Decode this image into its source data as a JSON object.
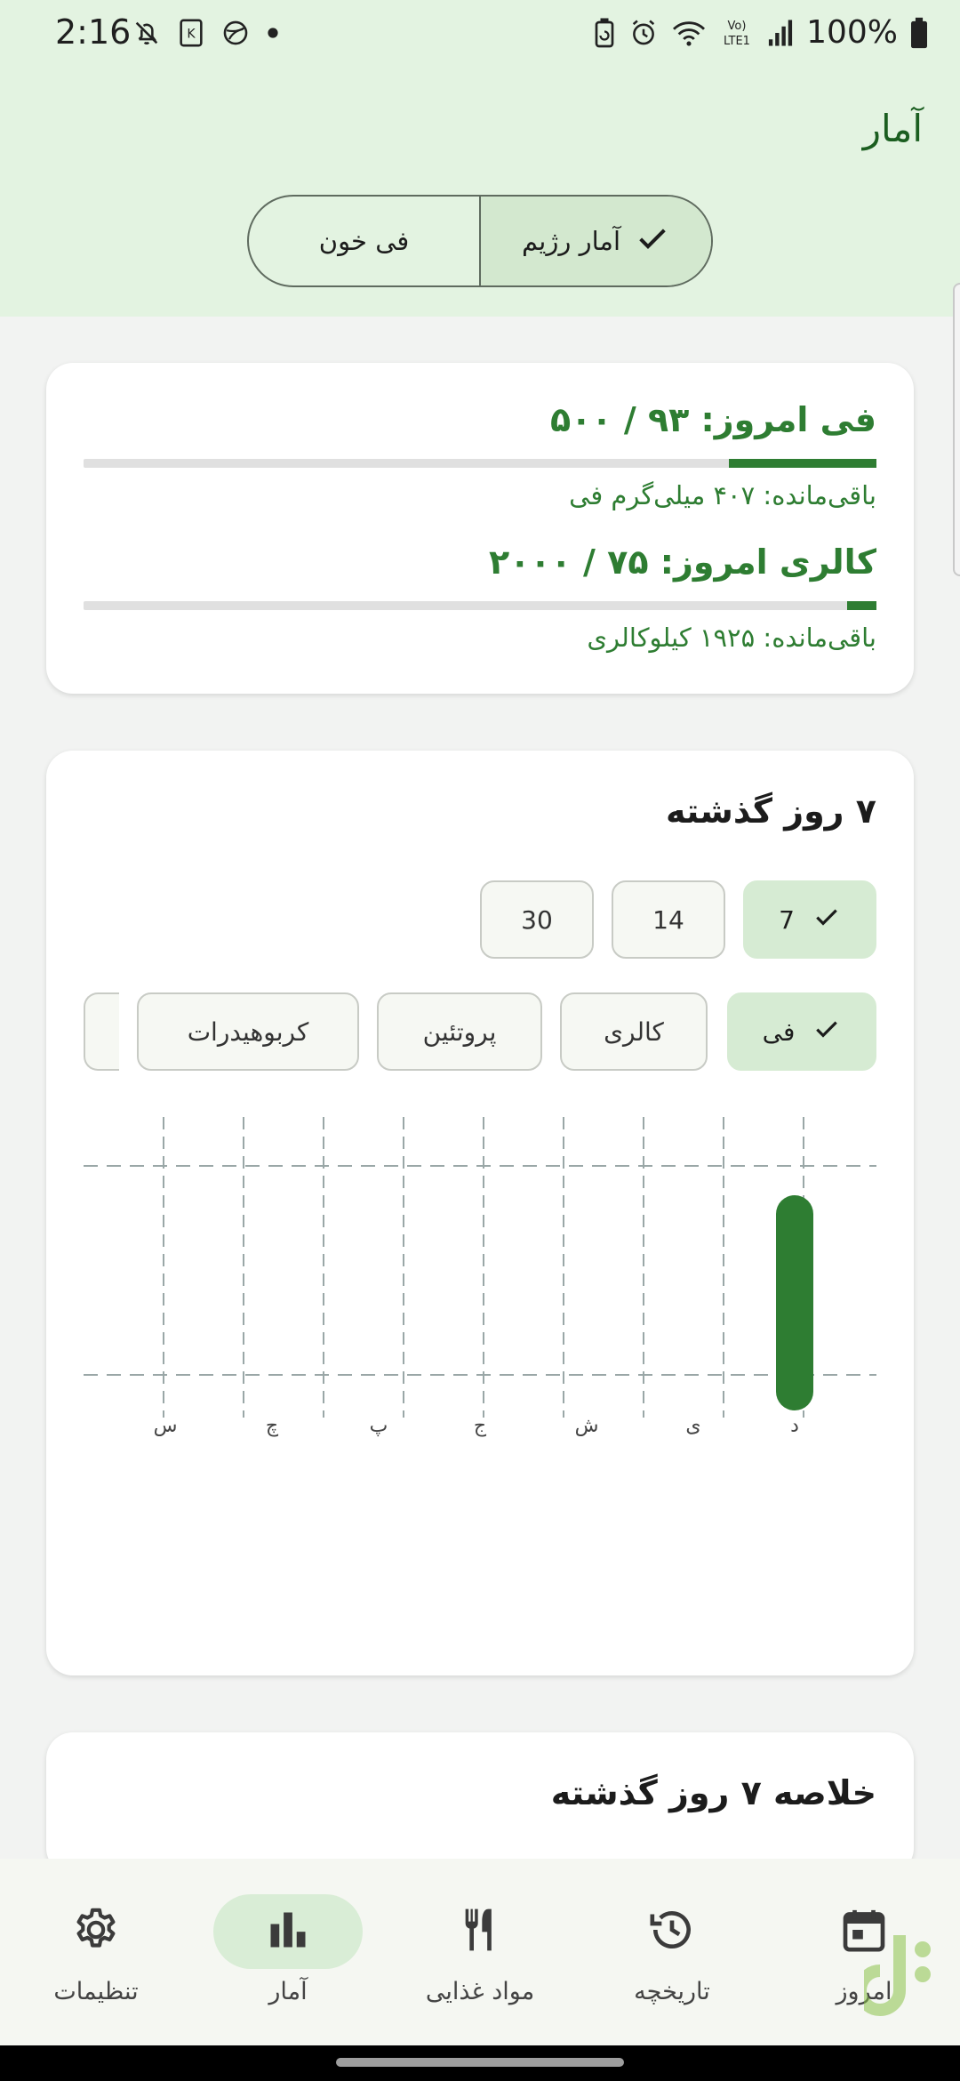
{
  "status_bar": {
    "time": "2:16",
    "battery": "100%",
    "network": "Vo) LTE1"
  },
  "header": {
    "title": "آمار",
    "toggle": {
      "selected": "آمار رژیم",
      "other": "فی خون"
    }
  },
  "today_card": {
    "phe_title": "فی امروز: ۹۳ / ۵۰۰",
    "phe_remaining": "باقی‌مانده: ۴۰۷ میلی‌گرم فی",
    "phe_progress": 0.186,
    "cal_title": "کالری امروز: ۷۵ / ۲۰۰۰",
    "cal_remaining": "باقی‌مانده: ۱۹۲۵ کیلوکالری",
    "cal_progress": 0.0375
  },
  "history_card": {
    "title": "۷ روز گذشته",
    "range_chips": [
      "7",
      "14",
      "30"
    ],
    "range_selected": "7",
    "metric_chips": [
      "فی",
      "کالری",
      "پروتئین",
      "کربوهیدرات"
    ],
    "metric_selected": "فی"
  },
  "chart_data": {
    "type": "bar",
    "categories": [
      "س",
      "چ",
      "پ",
      "ج",
      "ش",
      "ی",
      "د"
    ],
    "values": [
      0,
      0,
      0,
      0,
      0,
      0,
      93
    ],
    "ylim": [
      0,
      100
    ],
    "grid": true,
    "color": "#2e7d32"
  },
  "summary_card": {
    "title": "خلاصه ۷ روز گذشته"
  },
  "bottom_nav": {
    "items": [
      {
        "label": "تنظیمات",
        "icon": "gear-icon"
      },
      {
        "label": "آمار",
        "icon": "bar-chart-icon"
      },
      {
        "label": "مواد غذایی",
        "icon": "utensils-icon"
      },
      {
        "label": "تاریخچه",
        "icon": "history-icon"
      },
      {
        "label": "امروز",
        "icon": "calendar-icon"
      }
    ],
    "active": "آمار"
  },
  "colors": {
    "accent": "#2e7d32",
    "header_bg": "#e3f3e1",
    "selected_bg": "#d6ebd3"
  }
}
